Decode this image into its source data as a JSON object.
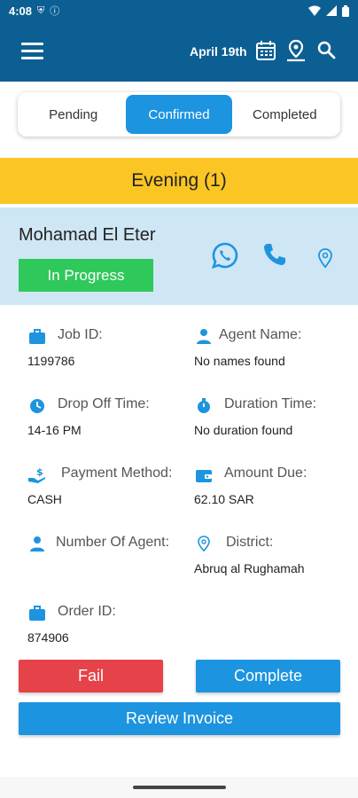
{
  "status_bar": {
    "time": "4:08"
  },
  "header": {
    "date": "April 19th"
  },
  "tabs": [
    {
      "label": "Pending"
    },
    {
      "label": "Confirmed"
    },
    {
      "label": "Completed"
    }
  ],
  "shift": {
    "label": "Evening (1)"
  },
  "customer": {
    "name": "Mohamad El Eter",
    "status": "In Progress"
  },
  "fields": {
    "job_id": {
      "label": "Job ID:",
      "value": "1199786"
    },
    "agent_name": {
      "label": "Agent Name:",
      "value": "No names found"
    },
    "drop_off_time": {
      "label": "Drop Off Time:",
      "value": "14-16 PM"
    },
    "duration_time": {
      "label": "Duration Time:",
      "value": "No duration found"
    },
    "payment_method": {
      "label": "Payment Method:",
      "value": "CASH"
    },
    "amount_due": {
      "label": "Amount Due:",
      "value": "62.10 SAR"
    },
    "number_of_agent": {
      "label": "Number Of Agent:",
      "value": ""
    },
    "district": {
      "label": "District:",
      "value": "Abruq al Rughamah"
    },
    "order_id": {
      "label": "Order ID:",
      "value": "874906"
    }
  },
  "actions": {
    "fail": "Fail",
    "complete": "Complete",
    "review_invoice": "Review Invoice"
  },
  "colors": {
    "primary": "#0c5f93",
    "accent": "#1d94df",
    "shift": "#fbc623",
    "status_in_progress": "#2ec95a",
    "danger": "#e6424a",
    "card_bg": "#cfe6f5"
  }
}
